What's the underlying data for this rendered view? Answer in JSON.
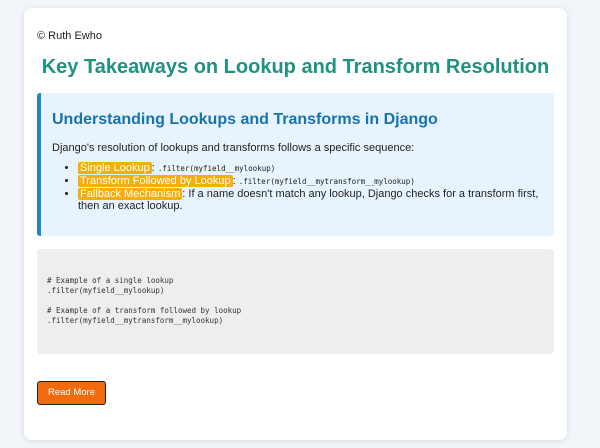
{
  "copyright": "© Ruth Ewho",
  "page_title": "Key Takeaways on Lookup and Transform Resolution",
  "section": {
    "heading": "Understanding Lookups and Transforms in Django",
    "intro": "Django's resolution of lookups and transforms follows a specific sequence:",
    "points": [
      {
        "label": "Single Lookup",
        "separator": ": ",
        "code": ".filter(myfield__mylookup)",
        "text": ""
      },
      {
        "label": "Transform Followed by Lookup",
        "separator": ": ",
        "code": ".filter(myfield__mytransform__mylookup)",
        "text": ""
      },
      {
        "label": "Fallback Mechanism",
        "separator": ": ",
        "code": "",
        "text": "If a name doesn't match any lookup, Django checks for a transform first, then an exact lookup."
      }
    ]
  },
  "code_block": {
    "lines": [
      "# Example of a single lookup",
      ".filter(myfield__mylookup)",
      "",
      "# Example of a transform followed by lookup",
      ".filter(myfield__mytransform__mylookup)"
    ]
  },
  "read_more_label": "Read More",
  "colors": {
    "title": "#1e9382",
    "heading": "#1673ad",
    "highlight": "#f6ae0b",
    "button": "#f26a0e",
    "info_border": "#1a8bc2"
  }
}
